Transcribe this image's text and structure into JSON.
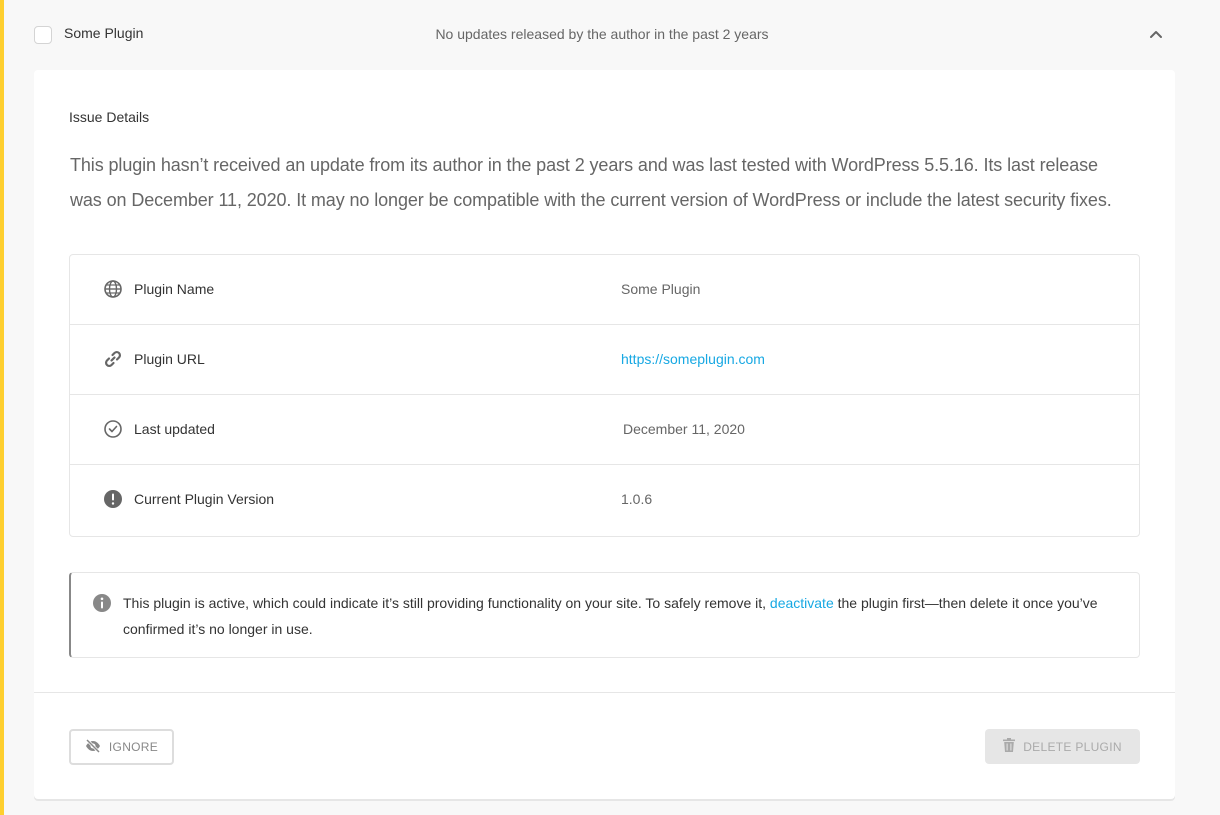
{
  "header": {
    "plugin_name": "Some Plugin",
    "summary": "No updates released by the author in the past 2 years"
  },
  "issue": {
    "title": "Issue Details",
    "description": "This plugin hasn’t received an update from its author in the past 2 years and was last tested with WordPress 5.5.16. Its last release was on December 11, 2020. It may no longer be compatible with the current version of WordPress or include the latest security fixes."
  },
  "details": [
    {
      "icon": "globe-icon",
      "label": "Plugin Name",
      "value": "Some Plugin"
    },
    {
      "icon": "link-icon",
      "label": "Plugin URL",
      "value": "https://someplugin.com"
    },
    {
      "icon": "clock-icon",
      "label": "Last updated",
      "value": "December 11, 2020"
    },
    {
      "icon": "warning-icon",
      "label": "Current Plugin Version",
      "value": "1.0.6"
    }
  ],
  "notice": {
    "text_before": "This plugin is active, which could indicate it’s still providing functionality on your site. To safely remove it, ",
    "link_text": "deactivate",
    "text_after": " the plugin first—then delete it once you’ve confirmed it’s no longer in use."
  },
  "actions": {
    "ignore_label": "IGNORE",
    "delete_label": "DELETE PLUGIN"
  },
  "colors": {
    "accent": "#fecf2f",
    "link": "#17a8e3"
  }
}
